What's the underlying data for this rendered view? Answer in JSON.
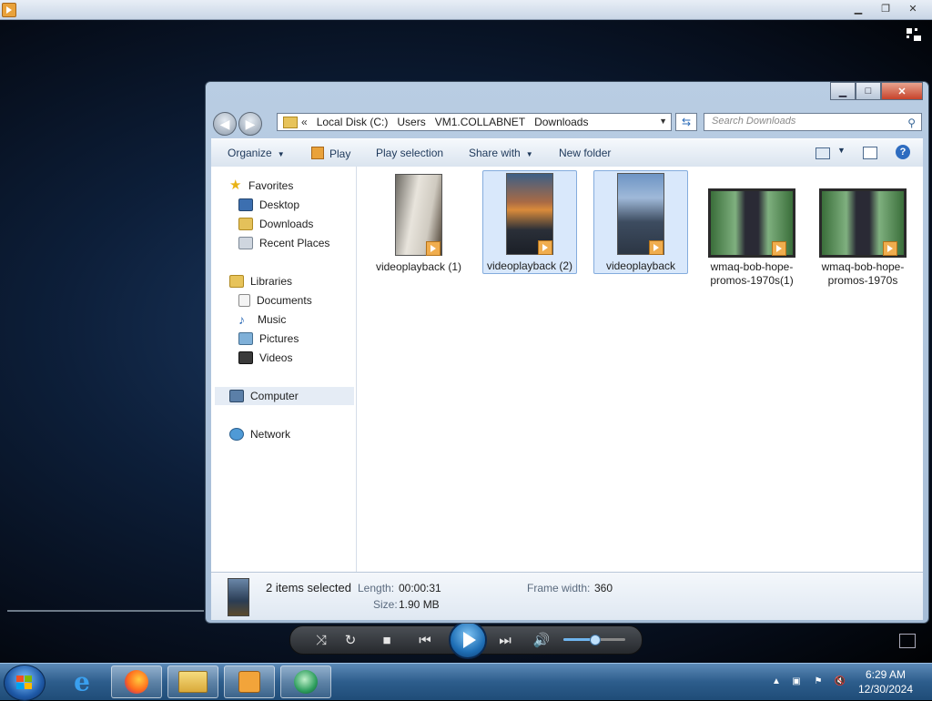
{
  "explorer": {
    "breadcrumb": {
      "overflow": "«",
      "parts": [
        "Local Disk (C:)",
        "Users",
        "VM1.COLLABNET",
        "Downloads"
      ]
    },
    "search_placeholder": "Search Downloads",
    "toolbar": {
      "organize": "Organize",
      "play": "Play",
      "play_selection": "Play selection",
      "share_with": "Share with",
      "new_folder": "New folder"
    },
    "nav": {
      "favorites": "Favorites",
      "desktop": "Desktop",
      "downloads": "Downloads",
      "recent_places": "Recent Places",
      "libraries": "Libraries",
      "documents": "Documents",
      "music": "Music",
      "pictures": "Pictures",
      "videos": "Videos",
      "computer": "Computer",
      "network": "Network"
    },
    "files": [
      {
        "name": "videoplayback (1)",
        "selected": false
      },
      {
        "name": "videoplayback (2)",
        "selected": true
      },
      {
        "name": "videoplayback",
        "selected": true
      },
      {
        "name": "wmaq-bob-hope-promos-1970s(1)",
        "selected": false
      },
      {
        "name": "wmaq-bob-hope-promos-1970s",
        "selected": false
      }
    ],
    "details": {
      "selection": "2 items selected",
      "length_label": "Length:",
      "length_value": "00:00:31",
      "size_label": "Size:",
      "size_value": "1.90 MB",
      "frame_width_label": "Frame width:",
      "frame_width_value": "360"
    }
  },
  "player": {
    "volume_level": 0.5
  },
  "taskbar": {
    "time": "6:29 AM",
    "date": "12/30/2024"
  },
  "colors": {
    "selection_fill": "#d9e8fb",
    "selection_border": "#84acdd",
    "link_text": "#1e395b"
  }
}
